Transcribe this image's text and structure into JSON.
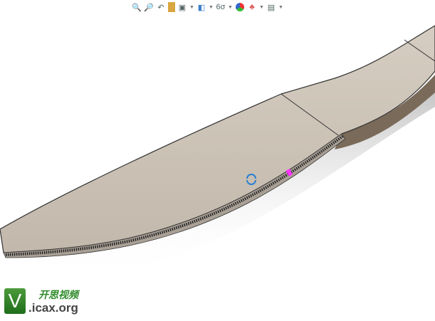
{
  "toolbar": {
    "icons": [
      "zoom-to-fit-icon",
      "zoom-to-area-icon",
      "previous-view-icon",
      "section-view-icon",
      "view-orientation-icon",
      "display-style-icon",
      "hide-show-items-icon",
      "edit-appearance-icon",
      "apply-scene-icon",
      "view-settings-icon"
    ]
  },
  "watermark": {
    "logo_letter": "V",
    "title": "开思视频",
    "url": ".icax.org"
  },
  "colors": {
    "blade": "#c9bfb2",
    "handle": "#cfc5b8",
    "highlight": "#ff33ff"
  }
}
